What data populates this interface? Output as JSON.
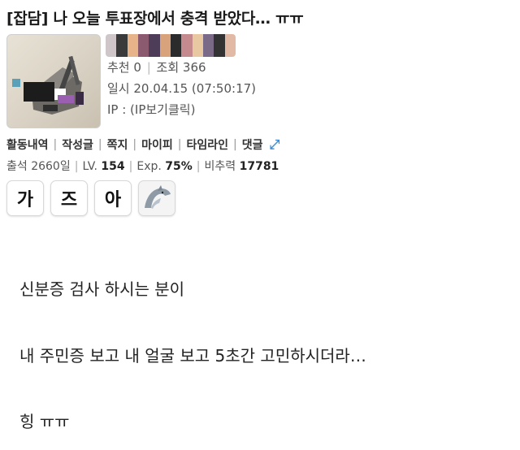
{
  "post": {
    "title": "[잡담] 나 오늘 투표장에서 충격 받았다… ㅠㅠ",
    "recommend": "추천 0",
    "views": "조회 366",
    "datetime": "일시 20.04.15 (07:50:17)",
    "ip": "IP : (IP보기클릭)"
  },
  "user_menu": [
    "활동내역",
    "작성글",
    "쪽지",
    "마이피",
    "타임라인",
    "댓글"
  ],
  "stats": {
    "attendance": "출석 2660일",
    "level_label": "LV.",
    "level": "154",
    "exp_label": "Exp.",
    "exp": "75%",
    "rank_label": "비추력",
    "rank": "17781"
  },
  "badges": [
    "가",
    "즈",
    "아",
    "dolphin-icon"
  ],
  "content": {
    "lines": [
      "신분증 검사 하시는 분이",
      "내 주민증 보고 내 얼굴 보고 5초간 고민하시더라…",
      "힝 ㅠㅠ"
    ]
  },
  "colors": {
    "accent": "#3a8fd6",
    "text": "#222222",
    "muted": "#555555"
  }
}
